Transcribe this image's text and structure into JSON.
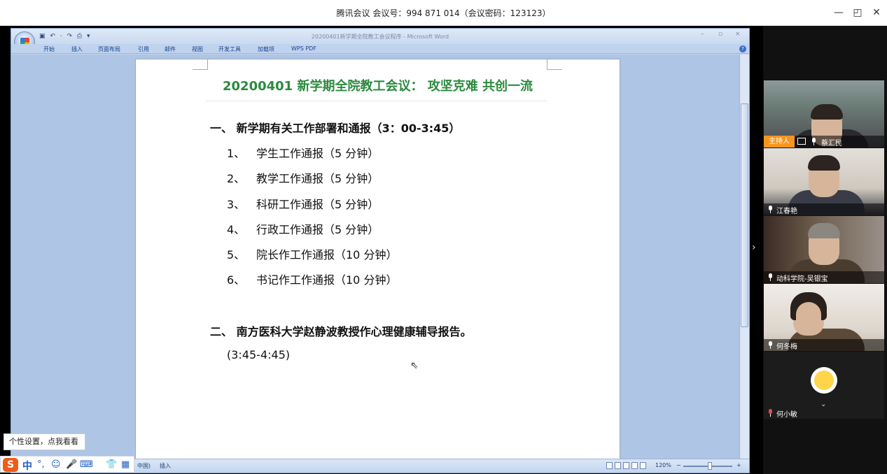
{
  "meeting": {
    "title": "腾讯会议 会议号：994 871 014（会议密码：123123）",
    "min": "—",
    "max": "◰",
    "close": "✕"
  },
  "word": {
    "window_title": "20200401新学期全院教工会议程序 - Microsoft Word",
    "qat": "▣ ↶ · ↷ ⎙ ▾",
    "tabs": [
      "开始",
      "插入",
      "页面布局",
      "引用",
      "邮件",
      "视图",
      "开发工具",
      "加载项",
      "WPS PDF"
    ],
    "status": {
      "lang": "中国)",
      "mode": "插入",
      "zoom": "120%",
      "zoom_minus": "−",
      "zoom_plus": "+"
    },
    "doc": {
      "heading": "20200401 新学期全院教工会议：  攻坚克难  共创一流",
      "section1": "一、  新学期有关工作部署和通报（3：00-3:45）",
      "items": [
        {
          "num": "1、",
          "text": "学生工作通报（5 分钟）"
        },
        {
          "num": "2、",
          "text": "教学工作通报（5 分钟）"
        },
        {
          "num": "3、",
          "text": "科研工作通报（5 分钟）"
        },
        {
          "num": "4、",
          "text": "行政工作通报（5 分钟）"
        },
        {
          "num": "5、",
          "text": "院长作工作通报（10 分钟）"
        },
        {
          "num": "6、",
          "text": "书记作工作通报（10 分钟）"
        }
      ],
      "section2": "二、  南方医科大学赵静波教授作心理健康辅导报告。",
      "section2_time": "(3:45-4:45)"
    }
  },
  "ime": {
    "tip": "个性设置，点我看看",
    "logo": "S",
    "mode": "中",
    "icons": [
      "°,",
      "☺",
      "🎤",
      "⌨",
      "👕",
      "▦"
    ]
  },
  "participants": [
    {
      "name": "蔡汇民",
      "host_label": "主持人",
      "is_host": true
    },
    {
      "name": "江春艳",
      "is_host": false
    },
    {
      "name": "动科学院-吴银宝",
      "is_host": false
    },
    {
      "name": "何冬梅",
      "is_host": false
    },
    {
      "name": "何小敏",
      "is_host": false,
      "avatar": "chick-icon"
    }
  ],
  "panel_toggle": "›"
}
